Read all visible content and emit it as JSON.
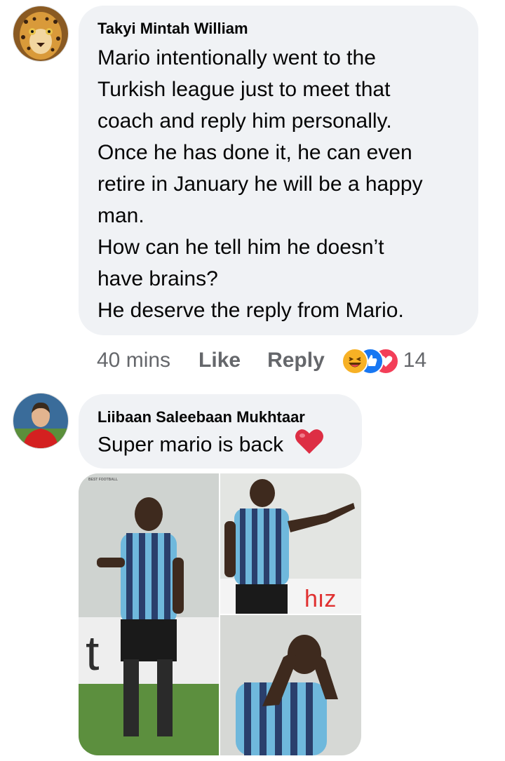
{
  "comments": [
    {
      "author": "Takyi Mintah William",
      "lines": [
        "Mario intentionally went to the",
        "Turkish league just to meet that",
        "coach and reply him personally.",
        "Once he has done it, he can even",
        "retire in January he will be a happy",
        "man.",
        "How can he tell him he doesn’t",
        "have brains?",
        "He deserve the reply from Mario."
      ],
      "time": "40 mins",
      "like_label": "Like",
      "reply_label": "Reply",
      "reactions": [
        "haha",
        "like",
        "love"
      ],
      "reaction_count": "14",
      "avatar": "leopard-avatar"
    },
    {
      "author": "Liibaan Saleebaan Mukhtaar",
      "text": "Super mario is back",
      "emoji": "red-heart",
      "avatar": "footballer-avatar",
      "photos": [
        "player-standing",
        "player-pointing",
        "player-hands-on-head"
      ],
      "photo_watermark": "BEST FOOTBALL"
    }
  ],
  "colors": {
    "bubble": "#f0f2f5",
    "meta_text": "#65676b",
    "like_blue": "#1877f2",
    "love_red": "#f33e58",
    "haha_yellow": "#f7b125",
    "jersey_blue": "#6fb8dc"
  }
}
